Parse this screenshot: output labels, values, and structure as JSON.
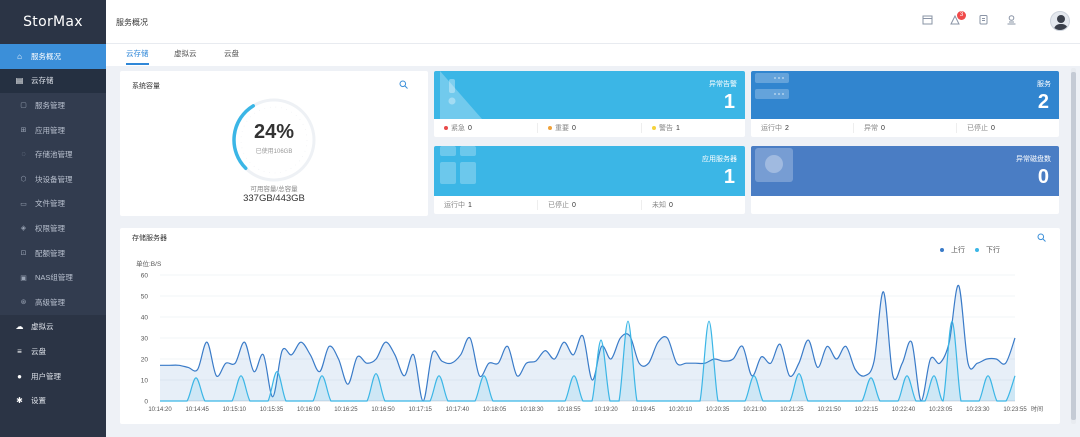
{
  "app": {
    "name": "StorMax"
  },
  "sidebar": {
    "items": [
      {
        "label": "服务概况",
        "icon": "home-icon",
        "glyph": "⌂",
        "kind": "active"
      },
      {
        "label": "云存储",
        "icon": "cloud-storage-icon",
        "glyph": "▤",
        "kind": "parent"
      },
      {
        "label": "服务管理",
        "icon": "service-icon",
        "glyph": "▢",
        "kind": "sub"
      },
      {
        "label": "应用管理",
        "icon": "apps-icon",
        "glyph": "⊞",
        "kind": "sub"
      },
      {
        "label": "存储池管理",
        "icon": "pool-icon",
        "glyph": "◌",
        "kind": "sub"
      },
      {
        "label": "块设备管理",
        "icon": "block-device-icon",
        "glyph": "⬡",
        "kind": "sub"
      },
      {
        "label": "文件管理",
        "icon": "file-icon",
        "glyph": "▭",
        "kind": "sub"
      },
      {
        "label": "权限管理",
        "icon": "permission-icon",
        "glyph": "◈",
        "kind": "sub"
      },
      {
        "label": "配额管理",
        "icon": "quota-icon",
        "glyph": "⊡",
        "kind": "sub"
      },
      {
        "label": "NAS组管理",
        "icon": "nas-icon",
        "glyph": "▣",
        "kind": "sub"
      },
      {
        "label": "高级管理",
        "icon": "advanced-icon",
        "glyph": "⊛",
        "kind": "sub"
      },
      {
        "label": "虚拟云",
        "icon": "virtual-cloud-icon",
        "glyph": "☁",
        "kind": "top"
      },
      {
        "label": "云盘",
        "icon": "cloud-disk-icon",
        "glyph": "≡",
        "kind": "top"
      },
      {
        "label": "用户管理",
        "icon": "user-icon",
        "glyph": "●",
        "kind": "top"
      },
      {
        "label": "设置",
        "icon": "settings-icon",
        "glyph": "✱",
        "kind": "top"
      }
    ]
  },
  "header": {
    "title": "服务概况",
    "notification_count": "3"
  },
  "tabs": [
    {
      "label": "云存储",
      "active": true
    },
    {
      "label": "虚拟云",
      "active": false
    },
    {
      "label": "云盘",
      "active": false
    }
  ],
  "capacity": {
    "title": "系统容量",
    "percent": "24%",
    "percent_value": 24,
    "used_label": "已使用106GB",
    "caption": "可用容量/总容量",
    "value": "337GB/443GB"
  },
  "stats": {
    "alerts": {
      "label": "异常告警",
      "value": "1",
      "color": "#3bb6e6",
      "items": [
        {
          "label": "紧急",
          "value": "0",
          "dot": "#e84b4b"
        },
        {
          "label": "重要",
          "value": "0",
          "dot": "#f0a23b"
        },
        {
          "label": "警告",
          "value": "1",
          "dot": "#f5d23b"
        }
      ]
    },
    "services": {
      "label": "服务",
      "value": "2",
      "color": "#3185cf",
      "items": [
        {
          "label": "运行中",
          "value": "2"
        },
        {
          "label": "异常",
          "value": "0"
        },
        {
          "label": "已停止",
          "value": "0"
        }
      ]
    },
    "app_servers": {
      "label": "应用服务器",
      "value": "1",
      "color": "#3bb6e6",
      "items": [
        {
          "label": "运行中",
          "value": "1"
        },
        {
          "label": "已停止",
          "value": "0"
        },
        {
          "label": "未知",
          "value": "0"
        }
      ]
    },
    "bad_disks": {
      "label": "异常磁盘数",
      "value": "0",
      "color": "#4a7dc4"
    }
  },
  "chart_data": {
    "type": "area",
    "title": "存储服务器",
    "ylabel": "单位:B/S",
    "xlabel": "时间",
    "ylim": [
      0,
      60
    ],
    "yticks": [
      0,
      10,
      20,
      30,
      40,
      50,
      60
    ],
    "xticks": [
      "10:14:20",
      "10:14:45",
      "10:15:10",
      "10:15:35",
      "10:16:00",
      "10:16:25",
      "10:16:50",
      "10:17:15",
      "10:17:40",
      "10:18:05",
      "10:18:30",
      "10:18:55",
      "10:19:20",
      "10:19:45",
      "10:20:10",
      "10:20:35",
      "10:21:00",
      "10:21:25",
      "10:21:50",
      "10:22:15",
      "10:22:40",
      "10:23:05",
      "10:23:30",
      "10:23:55"
    ],
    "legend_position": "top-right",
    "series": [
      {
        "name": "上行",
        "color": "#3a7bc8",
        "values": [
          17,
          17,
          17,
          16,
          15,
          28,
          12,
          18,
          18,
          28,
          14,
          22,
          2,
          24,
          22,
          28,
          22,
          14,
          26,
          20,
          8,
          21,
          18,
          20,
          28,
          22,
          12,
          22,
          0,
          23,
          19,
          18,
          22,
          30,
          12,
          18,
          18,
          26,
          12,
          18,
          19,
          24,
          20,
          28,
          22,
          31,
          10,
          26,
          20,
          30,
          31,
          18,
          18,
          28,
          30,
          18,
          18,
          18,
          18,
          20,
          19,
          20,
          26,
          12,
          21,
          18,
          27,
          12,
          18,
          29,
          16,
          26,
          20,
          26,
          15,
          12,
          19,
          52,
          12,
          18,
          28,
          0,
          20,
          18,
          28,
          55,
          18,
          18,
          20,
          20,
          18,
          30
        ]
      },
      {
        "name": "下行",
        "color": "#3bb6e6",
        "values": [
          0,
          0,
          0,
          0,
          11,
          0,
          0,
          0,
          0,
          12,
          0,
          0,
          0,
          14,
          0,
          0,
          0,
          0,
          12,
          0,
          0,
          0,
          0,
          0,
          13,
          0,
          0,
          0,
          0,
          0,
          0,
          12,
          0,
          0,
          0,
          0,
          12,
          0,
          0,
          0,
          0,
          0,
          0,
          0,
          0,
          0,
          12,
          0,
          0,
          29,
          0,
          0,
          38,
          0,
          0,
          0,
          0,
          0,
          0,
          0,
          0,
          38,
          0,
          0,
          0,
          0,
          12,
          0,
          0,
          0,
          0,
          13,
          0,
          0,
          0,
          0,
          0,
          0,
          0,
          11,
          0,
          0,
          0,
          12,
          0,
          0,
          12,
          0,
          38,
          0,
          0,
          0,
          12,
          0,
          0,
          12
        ]
      }
    ]
  }
}
